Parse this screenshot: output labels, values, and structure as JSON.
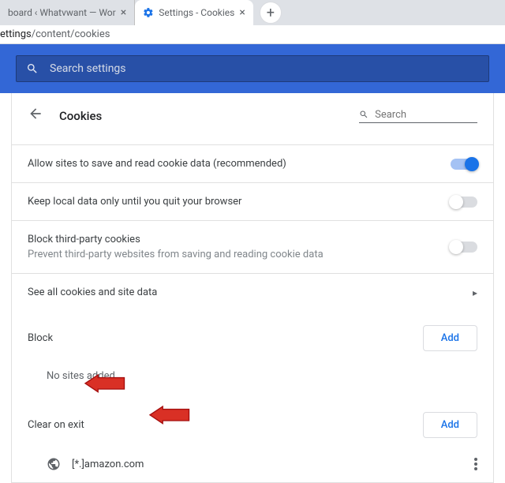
{
  "tabs": {
    "items": [
      {
        "title": "board ‹ Whatvwant — Wor"
      },
      {
        "title": "Settings - Cookies"
      }
    ]
  },
  "addressbar": {
    "path_dim": "ettings",
    "path_rest": "/content/cookies"
  },
  "searchSettings": {
    "placeholder": "Search settings"
  },
  "page": {
    "title": "Cookies",
    "searchPlaceholder": "Search"
  },
  "rows": {
    "allowSites": "Allow sites to save and read cookie data (recommended)",
    "keepLocal": "Keep local data only until you quit your browser",
    "blockThird": "Block third-party cookies",
    "blockThirdSub": "Prevent third-party websites from saving and reading cookie data",
    "seeAll": "See all cookies and site data"
  },
  "sections": {
    "block": {
      "label": "Block",
      "button": "Add",
      "empty": "No sites added"
    },
    "clearOnExit": {
      "label": "Clear on exit",
      "button": "Add"
    }
  },
  "sites": {
    "clearOnExit": [
      {
        "pattern": "[*.]amazon.com"
      }
    ]
  }
}
